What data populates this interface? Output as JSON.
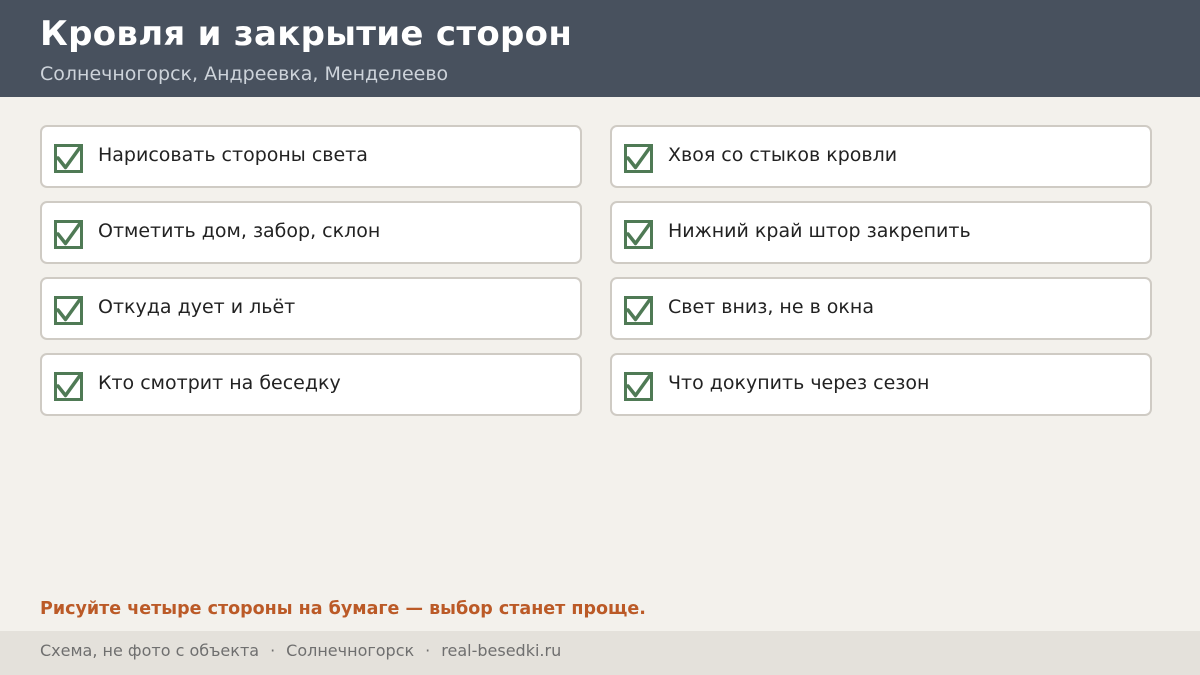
{
  "header": {
    "title": "Кровля и закрытие сторон",
    "subtitle": "Солнечногорск, Андреевка, Менделеево"
  },
  "checklist": {
    "left": [
      {
        "label": "Нарисовать стороны света",
        "checked": true
      },
      {
        "label": "Отметить дом, забор, склон",
        "checked": true
      },
      {
        "label": "Откуда дует и льёт",
        "checked": true
      },
      {
        "label": "Кто смотрит на беседку",
        "checked": true
      }
    ],
    "right": [
      {
        "label": "Хвоя со стыков кровли",
        "checked": true
      },
      {
        "label": "Нижний край штор закрепить",
        "checked": true
      },
      {
        "label": "Свет вниз, не в окна",
        "checked": true
      },
      {
        "label": "Что докупить через сезон",
        "checked": true
      }
    ]
  },
  "tip": "Рисуйте четыре стороны на бумаге — выбор станет проще.",
  "footer": {
    "note": "Схема, не фото с объекта",
    "city": "Солнечногорск",
    "site": "real-besedki.ru",
    "separator": "·"
  },
  "colors": {
    "header_bg": "#48515e",
    "check": "#4f7a55",
    "tip": "#bb5a27"
  },
  "icons": {
    "checkbox": "checkbox-checked-icon"
  }
}
